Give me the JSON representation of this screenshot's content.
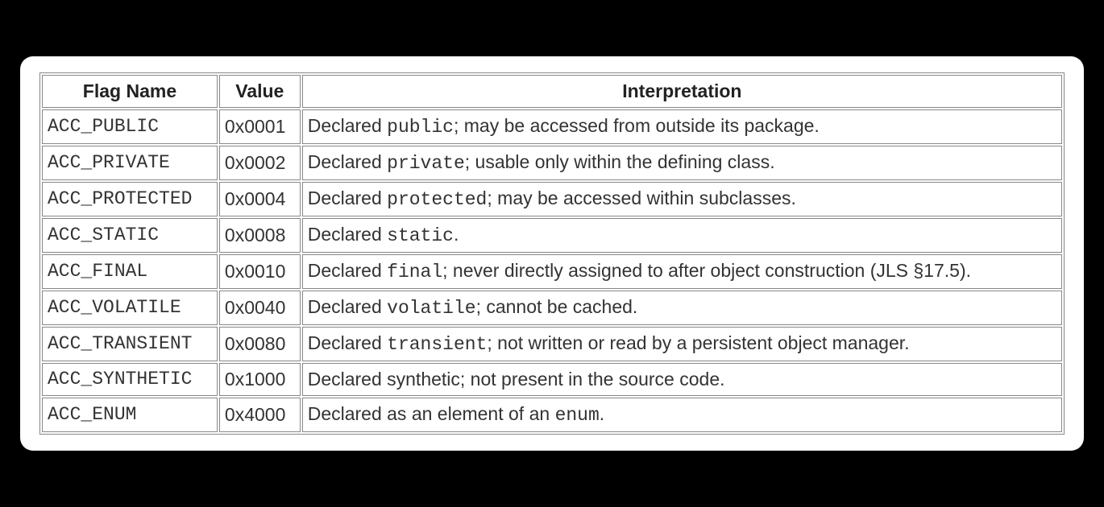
{
  "headers": {
    "flag": "Flag Name",
    "value": "Value",
    "interp": "Interpretation"
  },
  "rows": [
    {
      "flag": "ACC_PUBLIC",
      "value": "0x0001",
      "pre": "Declared ",
      "code": "public",
      "post": "; may be accessed from outside its package."
    },
    {
      "flag": "ACC_PRIVATE",
      "value": "0x0002",
      "pre": "Declared ",
      "code": "private",
      "post": "; usable only within the defining class."
    },
    {
      "flag": "ACC_PROTECTED",
      "value": "0x0004",
      "pre": "Declared ",
      "code": "protected",
      "post": "; may be accessed within subclasses."
    },
    {
      "flag": "ACC_STATIC",
      "value": "0x0008",
      "pre": "Declared ",
      "code": "static",
      "post": "."
    },
    {
      "flag": "ACC_FINAL",
      "value": "0x0010",
      "pre": "Declared ",
      "code": "final",
      "post": "; never directly assigned to after object construction (JLS §17.5)."
    },
    {
      "flag": "ACC_VOLATILE",
      "value": "0x0040",
      "pre": "Declared ",
      "code": "volatile",
      "post": "; cannot be cached."
    },
    {
      "flag": "ACC_TRANSIENT",
      "value": "0x0080",
      "pre": "Declared ",
      "code": "transient",
      "post": "; not written or read by a persistent object manager."
    },
    {
      "flag": "ACC_SYNTHETIC",
      "value": "0x1000",
      "pre": "Declared synthetic; not present in the source code.",
      "code": "",
      "post": ""
    },
    {
      "flag": "ACC_ENUM",
      "value": "0x4000",
      "pre": "Declared as an element of an ",
      "code": "enum",
      "post": "."
    }
  ]
}
